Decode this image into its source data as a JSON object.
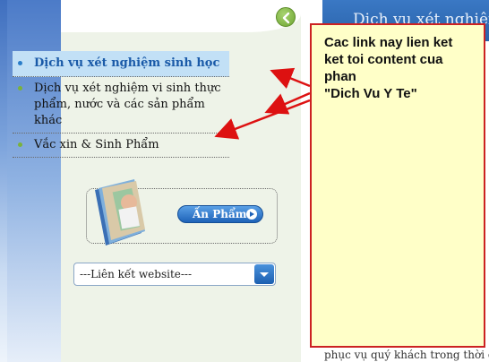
{
  "menu": {
    "items": [
      {
        "label": "Dịch vụ xét nghiệm sinh học",
        "active": true
      },
      {
        "label": "Dịch vụ xét nghiệm vi sinh thực phẩm, nước và các sản phẩm khác",
        "active": false
      },
      {
        "label": "Vắc xin & Sinh Phẩm",
        "active": false
      }
    ]
  },
  "banner": {
    "button_label": "Ấn Phẩm"
  },
  "links_select": {
    "selected": "---Liên kết website---"
  },
  "content": {
    "heading": "Dịch vụ xét nghiệm",
    "bottom_text": "phục vụ quý khách trong thời gia"
  },
  "annotation": {
    "lines": [
      "Cac link nay lien ket",
      "ket toi content cua",
      "phan",
      "\"Dich Vu Y Te\""
    ],
    "border_color": "#cc2222",
    "background": "#ffffc8"
  },
  "colors": {
    "accent_blue": "#2a7dc9",
    "active_bg": "#c2e0f6",
    "bullet_green": "#7ab23a",
    "arrow_red": "#dd1111"
  }
}
